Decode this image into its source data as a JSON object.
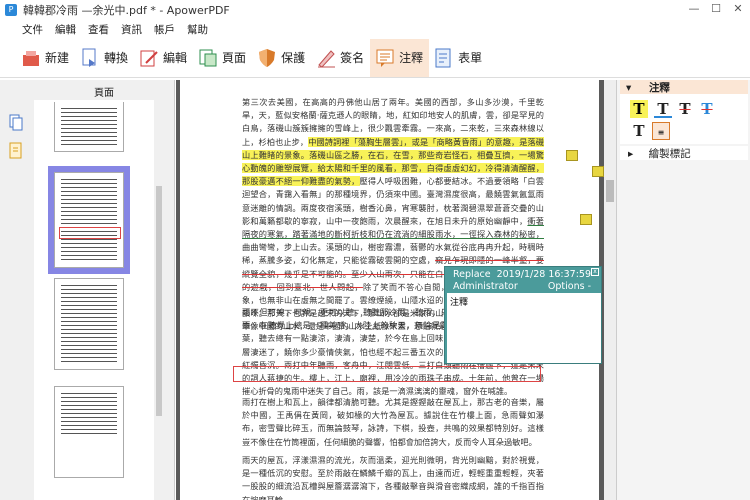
{
  "window": {
    "title": "韓韓郡冷雨 —余光中.pdf * - ApowerPDF",
    "minimize": "—",
    "maximize": "☐",
    "close": "✕"
  },
  "menu": [
    "文件",
    "編輯",
    "查看",
    "資訊",
    "帳戶",
    "幫助"
  ],
  "toolbar": [
    {
      "label": "新建",
      "icon": "new-icon"
    },
    {
      "label": "轉換",
      "icon": "convert-icon"
    },
    {
      "label": "編輯",
      "icon": "edit-icon"
    },
    {
      "label": "頁面",
      "icon": "page-icon"
    },
    {
      "label": "保護",
      "icon": "protect-icon"
    },
    {
      "label": "簽名",
      "icon": "sign-icon"
    },
    {
      "label": "注釋",
      "icon": "annotate-icon",
      "active": true
    },
    {
      "label": "表單",
      "icon": "form-icon"
    }
  ],
  "left_panel": {
    "header": "頁面"
  },
  "document": {
    "para1": "第三次去美國，在高高的丹佛他山居了兩年。美國的西部，多山多沙漠，千里乾旱，天，藍似安格蘭·薩克遜人的眼睛，地，紅如印地安人的肌膚，雲，卻是罕見的白鳥，落磯山簇簇擁擁的雪峰上，很少飄雲牽霧。一來高，二來乾，三來森林線以上，杉柏也止步，",
    "para1_hl": "中國詩詞裡「蕩胸生層雲」，或是「商略黃昏雨」的意趣，是落磯山上難睹的景象。落磯山區之勝，在石，在雪，那些奇岩怪石，相疊互擠，一場驚心動魄的雕塑展覽，給太陽和千里的風看，那雪，白得虛虛幻幻，冷得清清醒醒，那股豪邁不絕一仰難盡的氣勢，",
    "para1_tail": "壓得人呼吸困難，心都要結冰。不過要領略「白雲迴望合，青靄入看無」的那種境界，仍須來中國。臺灣濕度很高，最饒雲氣氤氳雨意迷離的情調。兩度夜宿溪頭，樹香沁鼻，宵寒襲肘，枕著潤碧濕翠蒼蒼交疊的山影和萬籟都歇的寧寂，山中一夜飽雨，次晨醒來，在旭日未升的原始幽靜中，",
    "para1_ul": "衝著隔夜的寒氣，踏著滿地的斷柯折枝和仍在流淌的細股雨水，一徑探入森林的秘密，",
    "para1_ul2": "曲曲彎彎，步上山去。溪頭的山，樹密霧濃，蓊鬱的水氣從谷底冉冉升起，時稠時稀，蒸騰多姿，幻化無定，只能從霧破雲開的空處，",
    "para1_strike": "窺見乍現即隱的一峰半壑，要縱覽全貌，幾乎是不可能的。至少入山兩次，只能在白茫茫裡和溪頭諸峰玩捉迷藏的遊戲，回到臺北，世人問起，",
    "para1_end": "除了笑而不答心自閒，故作神秘之外，實際的印象，也無非山在虛無之間罷了。雲缭煙繞，山隱水迢的中國風景，由來予人宋畫的韻味。那天下也許是趙宋的天下，那山水卻是米家的山水。而究竟，是米氏父子下筆像中國的山水，還是中國的山水上紙像宋畫，恐怕就是臺灣的一隻怪獸吧。",
    "para2": "雨不但可嗅，可親，更可以聽。聽聽那冷雨。聽雨，只要不是石破天驚的颱風暴雨，在聽覺上總是一種美感。大陸上的秋天，無論是疏雨滴梧桐，或是驟雨打荷葉，聽去總有一點淒涼，淒清，淒楚，於今在島上回味，則在淒楚之外，再籠上一層淒迷了，饒你多少豪情俠氣，怕也經不起三番五次的風吹雨打。一打少年聽雨，紅燭昏沉。兩打中年聽雨，客舟中，江闊雲低。三打白頭聽雨在僧廬下，這是宋末的詞人蔣捷的",
    "para2_box": "生。樓上，江上，廟裡，用冷冷的雨珠子串成。十年前，他曾在一場摧心折骨的鬼雨中迷失了自己。雨，該是一滴濕漓漓的靈魂，窗外在喊誰。",
    "para3": "雨打在樹上和瓦上，韻律都清脆可聽。尤其是鏗鏗敲在屋瓦上，那古老的音樂，屬於中國，王禹偁在黃岡，破如椽的大竹為屋瓦。據說住在竹樓上面，急雨聲如瀑布，密雪聲比碎玉，而無論鼓琴，詠詩，下棋，投壺，共鳴的效果都特別好。這樣豈不像住在竹筒裡面，任何細脆的聲響，怕都會加倍誇大，反而令人耳朵過敏吧。",
    "para4": "雨天的屋瓦，浮漾濕濕的流光，灰而溫柔，迎光則微明，背光則幽黯，對於視覺，是一種低沉的安慰。至於雨敲在鱗鱗千瓣的瓦上，由遠而近，輕輕重重輕輕，夾著一股股的細流沿瓦槽與屋簷潺潺瀉下，各種敲擊音與滑音密織成網，誰的千指百指在按摩耳輪。"
  },
  "popup": {
    "type": "Replace",
    "date": "2019/1/28 16:37:59",
    "author": "Administrator",
    "options": "Options -",
    "comment": "注釋",
    "close": "x"
  },
  "right_panel": {
    "header": "注釋",
    "drawing": "繪製標記",
    "header_arrow": "▾",
    "drawing_arrow": "▸"
  },
  "colors": {
    "accent": "#fbe6d5",
    "popup": "#4b9b9b",
    "highlight": "#f8f258",
    "strike": "#d33333"
  }
}
